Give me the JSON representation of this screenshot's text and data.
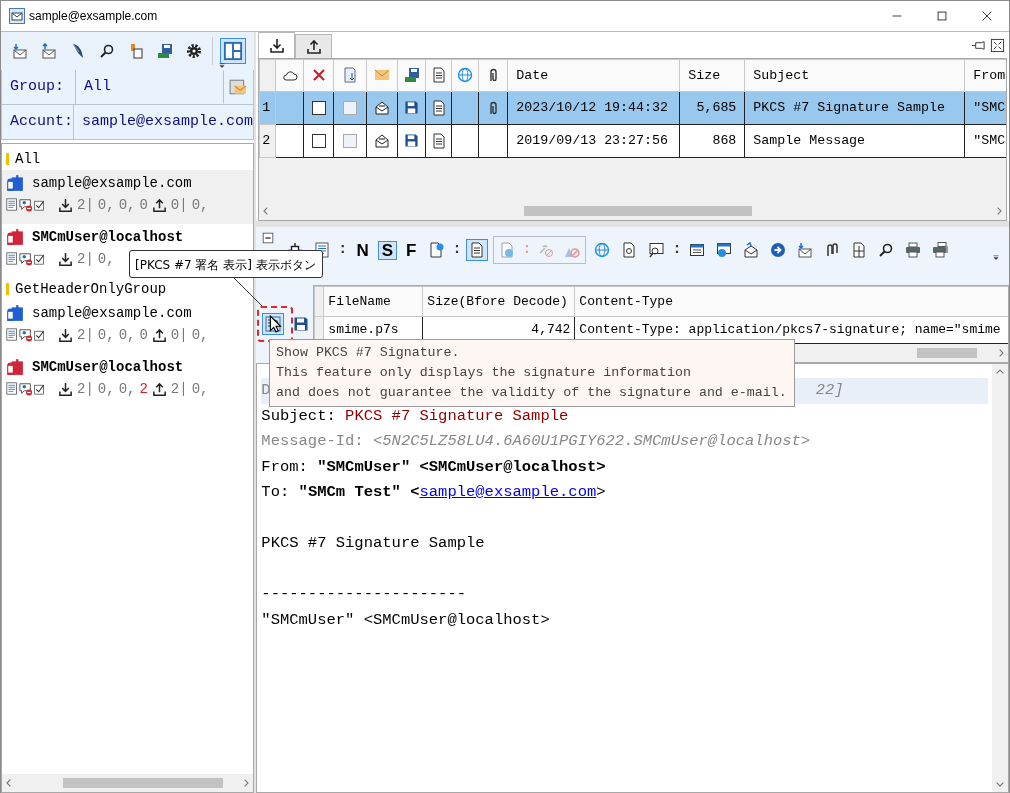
{
  "window": {
    "title": "sample@exsample.com"
  },
  "left_toolbar": [
    {
      "kind": "mail-in",
      "selected": false
    },
    {
      "kind": "mail-out",
      "selected": false
    },
    {
      "kind": "quill",
      "selected": false
    },
    {
      "kind": "search",
      "selected": false
    },
    {
      "kind": "note",
      "selected": false
    },
    {
      "kind": "drive",
      "selected": false
    },
    {
      "kind": "gear",
      "selected": false
    },
    {
      "kind": "layout",
      "selected": true
    }
  ],
  "filters": [
    {
      "label": "Group:",
      "value": "All"
    },
    {
      "label": "Accunt:",
      "value": "sample@exsample.com"
    }
  ],
  "tree": [
    {
      "name": "All",
      "accounts": [
        {
          "name": "sample@exsample.com",
          "kind": "imap",
          "selected": true,
          "received": "2|",
          "received_values": [
            {
              "text": "0,",
              "alert": false
            },
            {
              "text": "0,",
              "alert": false
            },
            {
              "text": "0",
              "alert": false
            }
          ],
          "sent": "0|",
          "sent_values": [
            "0,"
          ]
        },
        {
          "name": "SMCmUser@localhost",
          "kind": "pop",
          "selected": false,
          "received": "2|",
          "received_values": [
            {
              "text": "0,",
              "alert": false
            }
          ]
        }
      ]
    },
    {
      "name": "GetHeaderOnlyGroup",
      "accounts": [
        {
          "name": "sample@exsample.com",
          "kind": "imap",
          "selected": false,
          "received": "2|",
          "received_values": [
            {
              "text": "0,",
              "alert": false
            },
            {
              "text": "0,",
              "alert": false
            },
            {
              "text": "0",
              "alert": false
            }
          ],
          "sent": "0|",
          "sent_values": [
            "0,"
          ]
        },
        {
          "name": "SMCmUser@localhost",
          "kind": "pop",
          "selected": false,
          "received": "2|",
          "received_values": [
            {
              "text": "0,",
              "alert": false
            },
            {
              "text": "0,",
              "alert": false
            },
            {
              "text": "2",
              "alert": true
            }
          ],
          "sent": "2|",
          "sent_values": [
            "0,"
          ]
        }
      ]
    }
  ],
  "tabs": [
    {
      "kind": "download",
      "selected": true
    },
    {
      "kind": "upload",
      "selected": false
    }
  ],
  "messages": {
    "columns": [
      "Date",
      "Size",
      "Subject",
      "From"
    ],
    "rows": [
      {
        "number": "1",
        "selected": true,
        "delete": false,
        "mark": false,
        "attachment": true,
        "date": "2023/10/12 19:44:32",
        "size": "5,685",
        "subject": "PKCS #7 Signature Sample",
        "from": "\"SMC"
      },
      {
        "number": "2",
        "selected": false,
        "delete": false,
        "mark": false,
        "attachment": false,
        "date": "2019/09/13 23:27:56",
        "size": "868",
        "subject": "Sample Message",
        "from": "\"SMC"
      }
    ]
  },
  "message_toolbar": [
    {
      "kind": "fit",
      "selected": false,
      "disabled": false
    },
    {
      "kind": "lines",
      "selected": false,
      "disabled": false
    },
    {
      "kind": "separator",
      "label": ":",
      "disabled": false
    },
    {
      "kind": "letter",
      "label": "N",
      "selected": false,
      "disabled": false
    },
    {
      "kind": "letter",
      "label": "S",
      "selected": true,
      "disabled": false
    },
    {
      "kind": "letter",
      "label": "F",
      "selected": false,
      "disabled": false
    },
    {
      "kind": "doc-net",
      "selected": false,
      "disabled": false
    },
    {
      "kind": "separator",
      "label": ":",
      "disabled": false
    },
    {
      "kind": "doc",
      "selected": true,
      "disabled": false
    },
    {
      "kind": "doc-globe",
      "selected": false,
      "disabled": true
    },
    {
      "kind": "separator",
      "label": ":",
      "disabled": true
    },
    {
      "kind": "link-off",
      "selected": false,
      "disabled": true
    },
    {
      "kind": "shapes",
      "selected": false,
      "disabled": true
    },
    {
      "kind": "globe",
      "selected": false,
      "disabled": false
    },
    {
      "kind": "doc-at",
      "selected": false,
      "disabled": false
    },
    {
      "kind": "win-search",
      "selected": false,
      "disabled": false
    },
    {
      "kind": "separator",
      "label": ":",
      "disabled": false
    },
    {
      "kind": "window",
      "selected": false,
      "disabled": false
    },
    {
      "kind": "win-globe",
      "selected": false,
      "disabled": false
    },
    {
      "kind": "mail-reply",
      "selected": false,
      "disabled": false
    },
    {
      "kind": "play",
      "selected": false,
      "disabled": false
    },
    {
      "kind": "mail-in",
      "selected": false,
      "disabled": false
    },
    {
      "kind": "clips",
      "selected": false,
      "disabled": false
    },
    {
      "kind": "doc-split",
      "selected": false,
      "disabled": false
    },
    {
      "kind": "search",
      "selected": false,
      "disabled": false
    },
    {
      "kind": "print",
      "selected": false,
      "disabled": false
    },
    {
      "kind": "print-multi",
      "selected": false,
      "disabled": false
    }
  ],
  "attachments": {
    "columns": [
      "FileName",
      "Size(Bfore Decode)",
      "Content-Type"
    ],
    "rows": [
      {
        "cells": [
          "smime.p7s",
          "4,742",
          "Content-Type: application/pkcs7-signature; name=\"smime"
        ]
      }
    ]
  },
  "body": [
    {
      "kind": "covered",
      "start": "D",
      "end": "22]"
    },
    {
      "kind": "subject",
      "label": "Subject:",
      "value": "PKCS #7 Signature Sample"
    },
    {
      "kind": "message_id",
      "label": "Message-Id:",
      "value": "<5N2C5LZ58LU4.6A60U1PGIY622.SMCmUser@localhost>"
    },
    {
      "kind": "from",
      "label": "From:",
      "value": "\"SMCmUser\" <SMCmUser@localhost>"
    },
    {
      "kind": "to",
      "label": "To:",
      "value": "\"SMCm Test\" <",
      "link": "sample@exsample.com",
      "after": ">"
    },
    {
      "kind": "blank"
    },
    {
      "kind": "text",
      "text": "PKCS #7 Signature Sample"
    },
    {
      "kind": "blank"
    },
    {
      "kind": "text",
      "text": "----------------------"
    },
    {
      "kind": "text",
      "text": "\"SMCmUser\" <SMCmUser@localhost>"
    }
  ],
  "callout": {
    "text": "[PKCS #7 署名 表示] 表示ボタン"
  },
  "tooltip": {
    "lines": [
      "Show PKCS #7 Signature.",
      "This feature only displays the signature information",
      "and does not guarantee the validity of the signature and e-mail."
    ]
  }
}
